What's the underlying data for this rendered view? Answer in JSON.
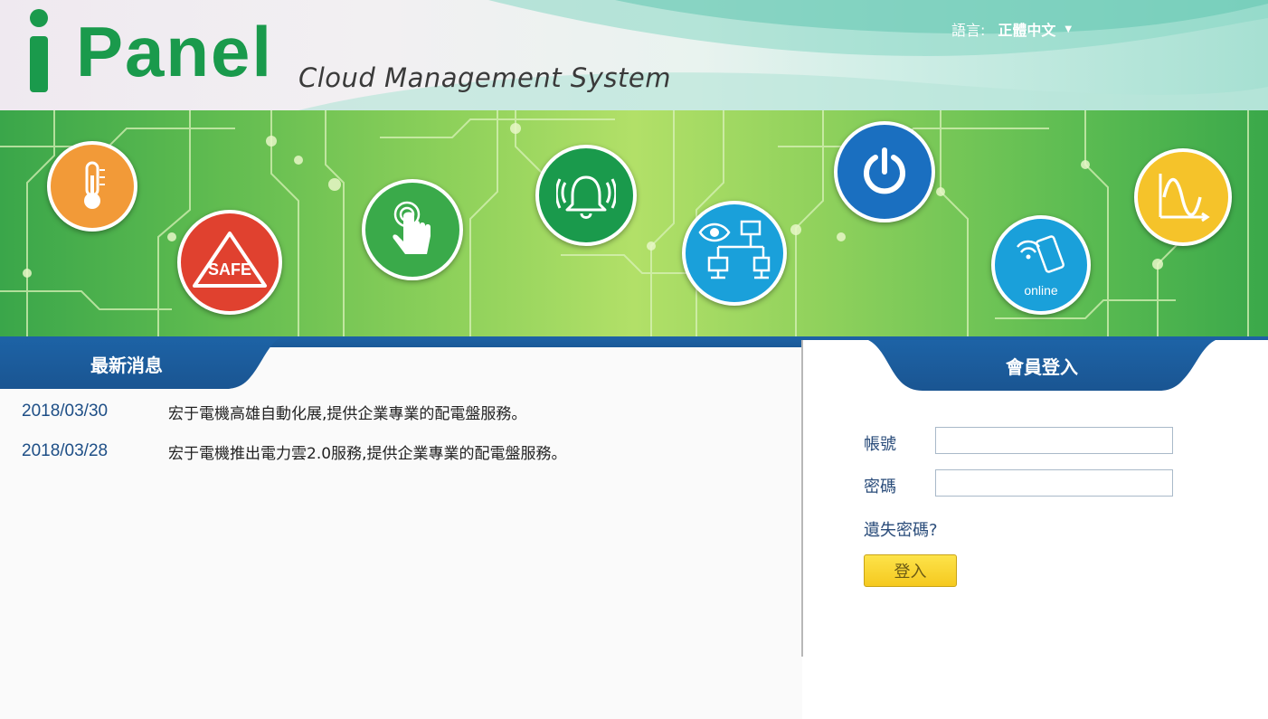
{
  "header": {
    "logo_i": "i",
    "logo_panel": "Panel",
    "logo_subtitle": "Cloud Management System",
    "language_label": "語言:",
    "language_value": "正體中文",
    "language_caret": "▼"
  },
  "banner": {
    "icons": [
      {
        "name": "thermometer-icon",
        "color": "#f29a38"
      },
      {
        "name": "safe-icon",
        "color": "#e0412f",
        "text": "SAFE"
      },
      {
        "name": "touch-hand-icon",
        "color": "#3aaa4a"
      },
      {
        "name": "alarm-bell-icon",
        "color": "#1a9a4c"
      },
      {
        "name": "network-monitor-icon",
        "color": "#1aa0da"
      },
      {
        "name": "power-icon",
        "color": "#1a6fc0"
      },
      {
        "name": "online-phone-icon",
        "color": "#1aa0da",
        "text": "online"
      },
      {
        "name": "waveform-chart-icon",
        "color": "#f5c32a"
      }
    ]
  },
  "news": {
    "title": "最新消息",
    "items": [
      {
        "date": "2018/03/30",
        "text": "宏于電機高雄自動化展,提供企業專業的配電盤服務。"
      },
      {
        "date": "2018/03/28",
        "text": "宏于電機推出電力雲2.0服務,提供企業專業的配電盤服務。"
      }
    ]
  },
  "login": {
    "title": "會員登入",
    "account_label": "帳號",
    "account_value": "",
    "password_label": "密碼",
    "password_value": "",
    "forgot_link": "遺失密碼?",
    "submit_label": "登入"
  },
  "colors": {
    "brand_green": "#1a9a4c",
    "bar_blue": "#1d63a6",
    "button_yellow": "#f5c91f",
    "text_blue": "#2a4c7a"
  }
}
